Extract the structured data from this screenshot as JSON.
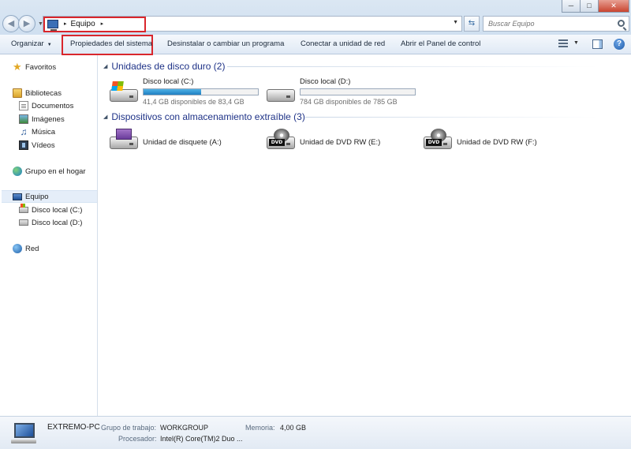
{
  "window": {
    "minimize_glyph": "─",
    "maximize_glyph": "□",
    "close_glyph": "✕"
  },
  "address_bar": {
    "breadcrumb": "Equipo",
    "separator": "▸",
    "trailing_separator": "▸"
  },
  "search": {
    "placeholder": "Buscar Equipo"
  },
  "command_bar": {
    "organize": "Organizar",
    "system_properties": "Propiedades del sistema",
    "uninstall": "Desinstalar o cambiar un programa",
    "map_drive": "Conectar a unidad de red",
    "control_panel": "Abrir el Panel de control",
    "help_glyph": "?"
  },
  "nav_pane": {
    "favorites": "Favoritos",
    "libraries": "Bibliotecas",
    "documents": "Documentos",
    "images": "Imágenes",
    "music": "Música",
    "videos": "Vídeos",
    "homegroup": "Grupo en el hogar",
    "computer": "Equipo",
    "drive_c": "Disco local (C:)",
    "drive_d": "Disco local (D:)",
    "network": "Red"
  },
  "content": {
    "hard_drives_header": "Unidades de disco duro (2)",
    "removable_header": "Dispositivos con almacenamiento extraíble (3)",
    "drives": [
      {
        "name": "Disco local (C:)",
        "free": "41,4 GB disponibles de 83,4 GB",
        "used_fraction": 0.504
      },
      {
        "name": "Disco local (D:)",
        "free": "784 GB disponibles de 785 GB",
        "used_fraction": 0.001
      }
    ],
    "devices": [
      {
        "name": "Unidad de disquete (A:)"
      },
      {
        "name": "Unidad de DVD RW (E:)",
        "badge": "DVD"
      },
      {
        "name": "Unidad de DVD RW (F:)",
        "badge": "DVD"
      }
    ]
  },
  "details": {
    "computer_name": "EXTREMO-PC",
    "workgroup_label": "Grupo de trabajo:",
    "workgroup_value": "WORKGROUP",
    "memory_label": "Memoria:",
    "memory_value": "4,00 GB",
    "processor_label": "Procesador:",
    "processor_value": "Intel(R) Core(TM)2 Duo ..."
  },
  "colors": {
    "highlight_red": "#d9262c",
    "group_header": "#1e3287",
    "usage_bar": "#2a8fd0"
  }
}
